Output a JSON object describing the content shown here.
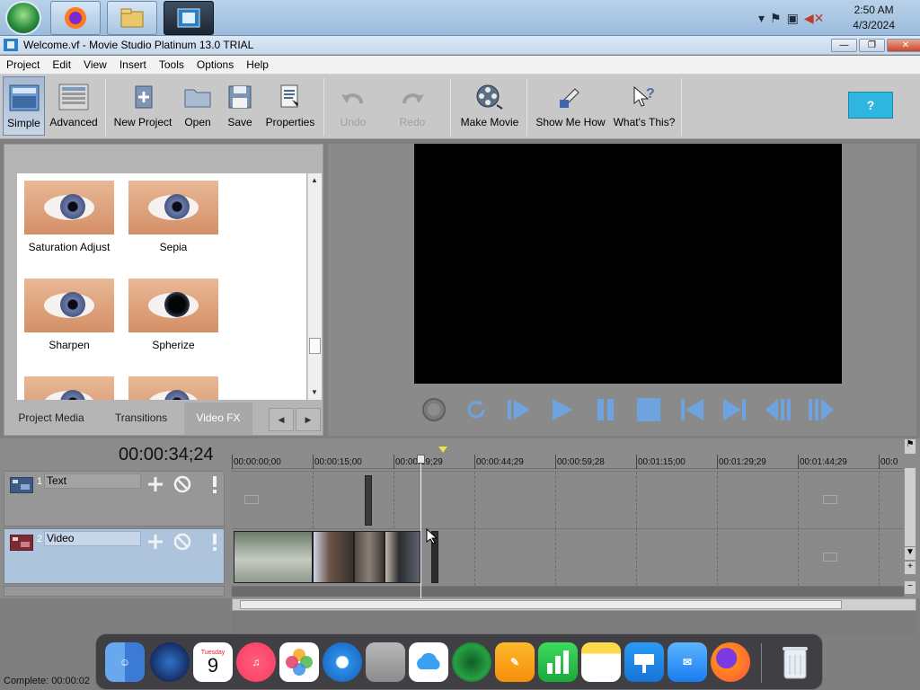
{
  "taskbar": {
    "clock_time": "2:50 AM",
    "clock_date": "4/3/2024",
    "pinned": [
      "start-orb",
      "firefox-icon",
      "file-explorer-icon",
      "movie-studio-icon"
    ]
  },
  "window": {
    "title": "Welcome.vf - Movie Studio Platinum 13.0 TRIAL",
    "controls": {
      "minimize": "—",
      "maximize": "❐",
      "close": "✕"
    }
  },
  "menu": [
    "Project",
    "Edit",
    "View",
    "Insert",
    "Tools",
    "Options",
    "Help"
  ],
  "toolbar": {
    "simple": "Simple",
    "advanced": "Advanced",
    "new_project": "New Project",
    "open": "Open",
    "save": "Save",
    "properties": "Properties",
    "undo": "Undo",
    "redo": "Redo",
    "make_movie": "Make Movie",
    "show_me_how": "Show Me How",
    "whats_this": "What's This?",
    "help_bubble": "?"
  },
  "fx_panel": {
    "effects": [
      "Saturation Adjust",
      "Sepia",
      "Sharpen",
      "Spherize"
    ],
    "tabs": [
      "Project Media",
      "Transitions",
      "Video FX"
    ],
    "active_tab": "Video FX",
    "nav_prev": "◀",
    "nav_next": "▶"
  },
  "timeline": {
    "timecode": "00:00:34;24",
    "ruler_labels": [
      "00:00:00;00",
      "00:00:15;00",
      "00:00:29;29",
      "00:00:44;29",
      "00:00:59;28",
      "00:01:15;00",
      "00:01:29;29",
      "00:01:44;29",
      "00:0"
    ],
    "tracks": [
      {
        "number": "1",
        "name": "Text"
      },
      {
        "number": "2",
        "name": "Video"
      }
    ]
  },
  "status": {
    "text": "Complete: 00:00:02"
  },
  "dock": {
    "calendar_month": "Tuesday",
    "calendar_day": "9",
    "apps": [
      "finder-icon",
      "siri-icon",
      "calendar-icon",
      "music-icon",
      "photos-icon",
      "safari-icon",
      "contacts-icon",
      "icloud-icon",
      "radar-icon",
      "pages-icon",
      "numbers-icon",
      "notes-icon",
      "keynote-icon",
      "mail-icon",
      "firefox-icon",
      "trash-icon"
    ]
  },
  "colors": {
    "preview_bg": "#000000",
    "selected_track": "#aec3dc",
    "active_tab": "#a8a8a8"
  }
}
